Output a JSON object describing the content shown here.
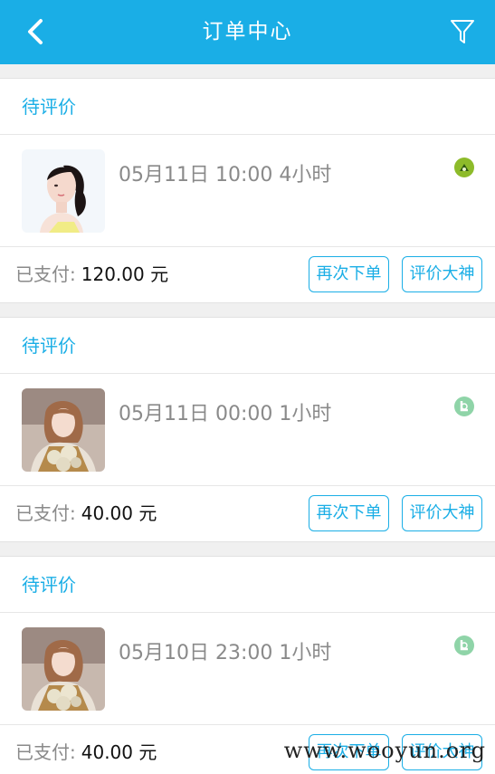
{
  "header": {
    "title": "订单中心",
    "back_icon": "chevron-left-icon",
    "filter_icon": "funnel-icon",
    "color": "#1aaee6"
  },
  "orders": [
    {
      "status": "待评价",
      "datetime": "05月11日 10:00",
      "duration": "4小时",
      "game_icon_color": "#8dbb2a",
      "paid_label": "已支付:",
      "amount": "120.00 元",
      "reorder_label": "再次下单",
      "review_label": "评价大神"
    },
    {
      "status": "待评价",
      "datetime": "05月11日 00:00",
      "duration": "1小时",
      "game_icon_color": "#8fd4a8",
      "paid_label": "已支付:",
      "amount": "40.00 元",
      "reorder_label": "再次下单",
      "review_label": "评价大神"
    },
    {
      "status": "待评价",
      "datetime": "05月10日 23:00",
      "duration": "1小时",
      "game_icon_color": "#8fd4a8",
      "paid_label": "已支付:",
      "amount": "40.00 元",
      "reorder_label": "再次下单",
      "review_label": "评价大神"
    }
  ],
  "watermark": "www.wooyun.org"
}
